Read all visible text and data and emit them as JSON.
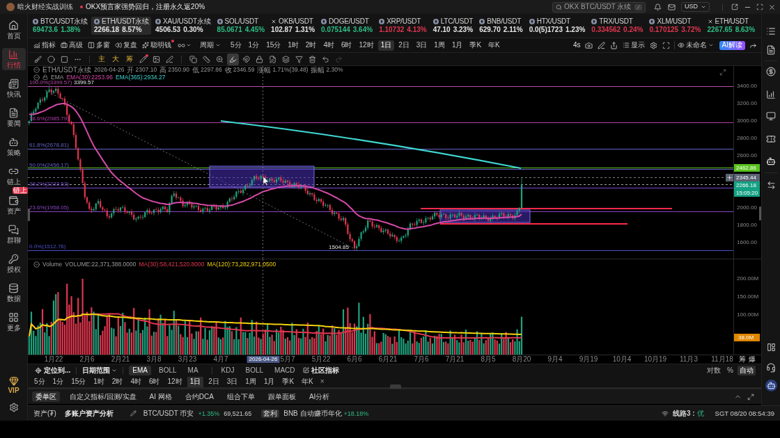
{
  "title_bar": {
    "app_name": "暗火财经实战训练",
    "announcement": "OKX预言家强势回归，注册永久返20%",
    "search": {
      "placeholder": "OKX BTC/USDT 永续",
      "shortcut": "/"
    },
    "currency": "USD"
  },
  "sidebar": {
    "items": [
      {
        "label": "首页",
        "selected": false
      },
      {
        "label": "行情",
        "selected": true
      },
      {
        "label": "快讯",
        "selected": false
      },
      {
        "label": "要闻",
        "selected": false
      },
      {
        "label": "策略",
        "selected": false
      },
      {
        "label": "链上",
        "selected": false
      },
      {
        "label": "资产",
        "selected": false,
        "badge": "链上"
      },
      {
        "label": "群聊",
        "selected": false
      },
      {
        "label": "授权",
        "selected": false
      },
      {
        "label": "数据",
        "selected": false
      },
      {
        "label": "更多",
        "selected": false
      }
    ],
    "vip": "VIP"
  },
  "tickers": [
    {
      "kind": "coin",
      "symbol": "BTC/USDT永续",
      "price": "69473.6",
      "change": "1.38%",
      "color": "#2ebd85",
      "selected": false
    },
    {
      "kind": "coin",
      "symbol": "ETH/USDT永续",
      "price": "2266.18",
      "change": "8.57%",
      "color": "#e6e6e6",
      "selected": true
    },
    {
      "kind": "coin",
      "symbol": "XAU/USDT永续",
      "price": "4506.53",
      "change": "0.30%",
      "color": "#e6e6e6",
      "selected": false
    },
    {
      "kind": "coin",
      "symbol": "SOL/USDT",
      "price": "85.0671",
      "change": "4.45%",
      "color": "#2ebd85",
      "selected": false
    },
    {
      "kind": "cross",
      "symbol": "OKB/USDT",
      "price": "102.87",
      "change": "1.31%",
      "color": "#e6e6e6",
      "selected": false
    },
    {
      "kind": "coin",
      "symbol": "DOGE/USDT",
      "price": "0.075144",
      "change": "3.64%",
      "color": "#2ebd85",
      "selected": false
    },
    {
      "kind": "coin",
      "symbol": "XRP/USDT",
      "price": "1.10732",
      "change": "4.13%",
      "color": "#e0364e",
      "selected": false
    },
    {
      "kind": "coin",
      "symbol": "LTC/USDT",
      "price": "47.10",
      "change": "3.23%",
      "color": "#e6e6e6",
      "selected": false
    },
    {
      "kind": "coin",
      "symbol": "BNB/USDT",
      "price": "629.70",
      "change": "2.11%",
      "color": "#e6e6e6",
      "selected": false
    },
    {
      "kind": "coin",
      "symbol": "HTX/USDT",
      "price": "0.0(5)1723",
      "change": "1.23%",
      "color": "#e6e6e6",
      "selected": false
    },
    {
      "kind": "coin",
      "symbol": "TRX/USDT",
      "price": "0.334562",
      "change": "0.24%",
      "color": "#e0364e",
      "selected": false
    },
    {
      "kind": "coin",
      "symbol": "XLM/USDT",
      "price": "0.170125",
      "change": "3.72%",
      "color": "#e0364e",
      "selected": false
    },
    {
      "kind": "cross",
      "symbol": "ETH/USDT",
      "price": "2267.65",
      "change": "8.63%",
      "color": "#2ebd85",
      "selected": false
    }
  ],
  "toolbar": {
    "tools": [
      {
        "label": "指标",
        "notification": false
      },
      {
        "label": "高级",
        "notification": false
      },
      {
        "label": "多窗",
        "notification": false
      },
      {
        "label": "复盘",
        "notification": false
      },
      {
        "label": "聪明钱",
        "notification": true
      }
    ],
    "period_menu": "周期",
    "periods": [
      {
        "label": "5分",
        "selected": false
      },
      {
        "label": "1分",
        "selected": false
      },
      {
        "label": "15分",
        "selected": false
      },
      {
        "label": "1时",
        "selected": false
      },
      {
        "label": "2时",
        "selected": false
      },
      {
        "label": "4时",
        "selected": false
      },
      {
        "label": "6时",
        "selected": false
      },
      {
        "label": "12时",
        "selected": false
      },
      {
        "label": "1日",
        "selected": true
      },
      {
        "label": "2日",
        "selected": false
      },
      {
        "label": "3日",
        "selected": false
      },
      {
        "label": "1周",
        "selected": false
      },
      {
        "label": "1月",
        "selected": false
      },
      {
        "label": "季K",
        "selected": false
      },
      {
        "label": "年K",
        "selected": false
      }
    ],
    "refresh": "4s",
    "display": "显示",
    "layout_name": "未命名",
    "ai_button": "AI解读"
  },
  "drawing_tools": [
    {
      "kind": "icon",
      "selected": false,
      "disabled": false,
      "notification": false
    },
    {
      "kind": "icon",
      "selected": false,
      "disabled": false,
      "notification": false
    },
    {
      "kind": "icon",
      "selected": false,
      "disabled": false,
      "notification": false
    },
    {
      "kind": "icon",
      "selected": false,
      "disabled": false,
      "notification": false
    },
    {
      "kind": "text",
      "label": "主",
      "selected": false,
      "disabled": false,
      "notification": false
    },
    {
      "kind": "text",
      "label": "大",
      "selected": false,
      "disabled": false,
      "notification": false
    },
    {
      "kind": "text",
      "label": "筹",
      "selected": false,
      "disabled": false,
      "notification": false
    },
    {
      "kind": "icon",
      "selected": false,
      "disabled": false,
      "notification": true
    },
    {
      "kind": "icon",
      "selected": false,
      "disabled": false,
      "notification": false
    },
    {
      "kind": "icon",
      "selected": false,
      "disabled": false,
      "notification": false
    },
    {
      "kind": "icon",
      "selected": false,
      "disabled": false,
      "notification": false
    },
    {
      "kind": "icon",
      "selected": false,
      "disabled": false,
      "notification": false
    },
    {
      "kind": "icon",
      "selected": false,
      "disabled": false,
      "notification": false
    },
    {
      "kind": "icon",
      "selected": true,
      "disabled": false,
      "notification": false
    },
    {
      "kind": "icon",
      "selected": false,
      "disabled": false,
      "notification": false
    },
    {
      "kind": "icon",
      "selected": false,
      "disabled": false,
      "notification": false
    },
    {
      "kind": "icon",
      "selected": false,
      "disabled": false,
      "notification": false
    },
    {
      "kind": "icon",
      "selected": false,
      "disabled": false,
      "notification": false
    },
    {
      "kind": "icon",
      "selected": false,
      "disabled": false,
      "notification": false
    },
    {
      "kind": "icon",
      "selected": false,
      "disabled": false,
      "notification": false
    },
    {
      "kind": "icon",
      "selected": false,
      "disabled": false,
      "notification": false
    },
    {
      "kind": "icon",
      "selected": false,
      "disabled": true,
      "notification": false
    }
  ],
  "chart": {
    "legend": {
      "symbol": "ETH/USDT永续",
      "date": "2026-04-26",
      "fields": [
        {
          "label": "开",
          "value": "2307.10"
        },
        {
          "label": "高",
          "value": "2350.90"
        },
        {
          "label": "低",
          "value": "2297.86"
        },
        {
          "label": "收",
          "value": "2346.59"
        },
        {
          "label": "涨幅",
          "value": "1.71%(39.48)"
        },
        {
          "label": "振幅",
          "value": "2.30%"
        }
      ]
    },
    "indicator": {
      "name": "EMA",
      "lines": [
        {
          "label": "EMA(30):2253.96",
          "color": "#d64aa8"
        },
        {
          "label": "EMA(365):2934.27",
          "color": "#3fd8d2"
        }
      ]
    },
    "fib_levels": [
      {
        "label": "100.0%(3399.57)",
        "color": "#b84aa6"
      },
      {
        "label": "78.6%(2985.79)",
        "color": "#b03fa8"
      },
      {
        "label": "61.8%(2678.81)",
        "color": "#6464c8"
      },
      {
        "label": "50.0%(2456.17)",
        "color": "#6a62d0"
      },
      {
        "label": "38.2%(2233.53)",
        "color": "#7a4ad6"
      },
      {
        "label": "23.6%(1958.05)",
        "color": "#8a46c4"
      },
      {
        "label": "0.0%(1512.76)",
        "color": "#4e4ec8"
      }
    ],
    "high_label": "3399.57",
    "low_label": "1504.85",
    "price_axis": [
      "3400.00",
      "3200.00",
      "3000.00",
      "2800.00",
      "2600.00",
      "2000.00",
      "1800.00",
      "1600.00"
    ],
    "price_tags": [
      {
        "label": "2462.86",
        "color": "#58c21e"
      },
      {
        "label": "2345.44",
        "color": "#5b6272"
      },
      {
        "label": "2266.18",
        "color": "#14a184"
      },
      {
        "label": "15:05:20",
        "color": "#14a184"
      }
    ],
    "volume": {
      "name": "Volume",
      "value": "VOLUME:22,371,388.0000",
      "ma": [
        {
          "label": "MA(30):58,421,520.8000",
          "color": "#e0364e"
        },
        {
          "label": "MA(120):73,282,971.0500",
          "color": "#f2d20c"
        }
      ],
      "axis": [
        "200.00M",
        "150.00M",
        "100.00M"
      ],
      "tag": {
        "label": "38.0M",
        "color": "#e08600"
      }
    },
    "time_axis": [
      {
        "label": "1月22",
        "kind": "tick"
      },
      {
        "label": "2月6",
        "kind": "tick"
      },
      {
        "label": "2月21",
        "kind": "tick"
      },
      {
        "label": "3月8",
        "kind": "tick"
      },
      {
        "label": "3月23",
        "kind": "tick"
      },
      {
        "label": "4月7",
        "kind": "tick"
      },
      {
        "label": "2026-04-26",
        "kind": "crosshair"
      },
      {
        "label": "5月7",
        "kind": "tick"
      },
      {
        "label": "5月22",
        "kind": "tick"
      },
      {
        "label": "6月6",
        "kind": "tick"
      },
      {
        "label": "6月21",
        "kind": "tick"
      },
      {
        "label": "7月6",
        "kind": "tick"
      },
      {
        "label": "7月21",
        "kind": "tick"
      },
      {
        "label": "8月5",
        "kind": "tick"
      },
      {
        "label": "8月20",
        "kind": "tick"
      },
      {
        "label": "9月4",
        "kind": "tick"
      },
      {
        "label": "9月19",
        "kind": "tick"
      },
      {
        "label": "10月4",
        "kind": "tick"
      },
      {
        "label": "10月19",
        "kind": "tick"
      },
      {
        "label": "11月3",
        "kind": "tick"
      },
      {
        "label": "11月18",
        "kind": "tick"
      }
    ],
    "corner_buttons": [
      "筹",
      "爆"
    ]
  },
  "bottom_toolbar": {
    "locate": "定位到...",
    "date_range": "日期范围",
    "main_indicators": [
      {
        "label": "EMA",
        "selected": true
      },
      {
        "label": "BOLL",
        "selected": false
      },
      {
        "label": "MA",
        "selected": false
      }
    ],
    "sub_indicators": [
      "KDJ",
      "BOLL",
      "MACD"
    ],
    "community": "社区指标",
    "scale_options": [
      {
        "label": "对数",
        "selected": false
      },
      {
        "label": "%",
        "selected": false
      },
      {
        "label": "自动",
        "selected": true
      }
    ]
  },
  "period_bar": {
    "periods": [
      {
        "label": "5分",
        "selected": false
      },
      {
        "label": "1分",
        "selected": false
      },
      {
        "label": "15分",
        "selected": false
      },
      {
        "label": "1时",
        "selected": false
      },
      {
        "label": "2时",
        "selected": false
      },
      {
        "label": "4时",
        "selected": false
      },
      {
        "label": "6时",
        "selected": false
      },
      {
        "label": "12时",
        "selected": false
      },
      {
        "label": "1日",
        "selected": true
      },
      {
        "label": "2日",
        "selected": false
      },
      {
        "label": "3日",
        "selected": false
      },
      {
        "label": "1周",
        "selected": false
      },
      {
        "label": "1月",
        "selected": false
      },
      {
        "label": "季K",
        "selected": false
      },
      {
        "label": "年K",
        "selected": false
      }
    ],
    "close": "×"
  },
  "panel_tabs": [
    {
      "label": "委单区",
      "selected": true
    },
    {
      "label": "自定义指标/回测/实盘",
      "selected": false
    },
    {
      "label": "AI 网格",
      "selected": false
    },
    {
      "label": "合约DCA",
      "selected": false
    },
    {
      "label": "组合下单",
      "selected": false
    },
    {
      "label": "跟单面板",
      "selected": false
    },
    {
      "label": "AI分析",
      "selected": false
    }
  ],
  "status_bar": {
    "assets": "资产(₮)",
    "analysis": "多账户资产分析",
    "pair": "BTC/USDT 币安",
    "pair_change": "+1.35%",
    "pair_price": "69,521.65",
    "badge": "套利",
    "promo": "BNB 自动赚币年化",
    "promo_rate": "+18.18%",
    "line": "线路3 :",
    "line_quality": "优",
    "clock": "SGT 08/20 08:54:39"
  }
}
